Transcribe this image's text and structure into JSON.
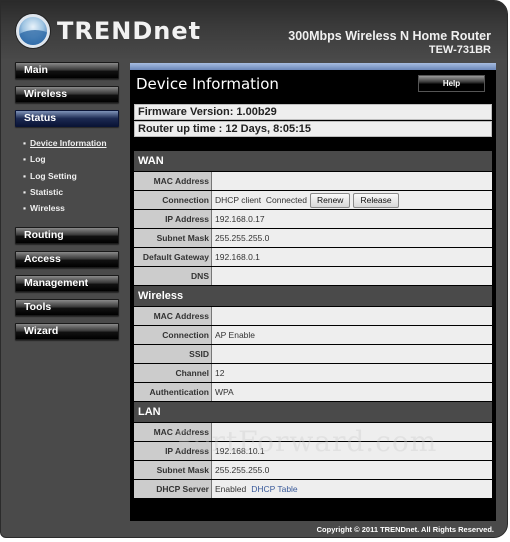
{
  "header": {
    "brand": "TRENDnet",
    "product_line": "300Mbps Wireless N Home Router",
    "model": "TEW-731BR"
  },
  "sidebar": {
    "items": [
      {
        "label": "Main"
      },
      {
        "label": "Wireless"
      },
      {
        "label": "Status",
        "active": true,
        "subitems": [
          {
            "label": "Device Information",
            "active": true
          },
          {
            "label": "Log"
          },
          {
            "label": "Log Setting"
          },
          {
            "label": "Statistic"
          },
          {
            "label": "Wireless"
          }
        ]
      },
      {
        "label": "Routing"
      },
      {
        "label": "Access"
      },
      {
        "label": "Management"
      },
      {
        "label": "Tools"
      },
      {
        "label": "Wizard"
      }
    ],
    "bullet": "▪"
  },
  "main": {
    "title": "Device Information",
    "help_label": "Help",
    "firmware": "Firmware Version: 1.00b29",
    "uptime": "Router up time :  12 Days, 8:05:15",
    "wan": {
      "title": "WAN",
      "rows": [
        {
          "key": "MAC Address",
          "value": ""
        },
        {
          "key": "Connection",
          "value": "DHCP client  Connected"
        },
        {
          "key": "IP Address",
          "value": "192.168.0.17"
        },
        {
          "key": "Subnet Mask",
          "value": "255.255.255.0"
        },
        {
          "key": "Default Gateway",
          "value": "192.168.0.1"
        },
        {
          "key": "DNS",
          "value": ""
        }
      ],
      "renew_label": "Renew",
      "release_label": "Release"
    },
    "wireless": {
      "title": "Wireless",
      "rows": [
        {
          "key": "MAC Address",
          "value": ""
        },
        {
          "key": "Connection",
          "value": "AP Enable"
        },
        {
          "key": "SSID",
          "value": ""
        },
        {
          "key": "Channel",
          "value": "12"
        },
        {
          "key": "Authentication",
          "value": "WPA"
        }
      ]
    },
    "lan": {
      "title": "LAN",
      "rows": [
        {
          "key": "MAC Address",
          "value": ""
        },
        {
          "key": "IP Address",
          "value": "192.168.10.1"
        },
        {
          "key": "Subnet Mask",
          "value": "255.255.255.0"
        },
        {
          "key": "DHCP Server",
          "value": "Enabled"
        }
      ],
      "dhcp_table_link": "DHCP Table"
    }
  },
  "footer": {
    "copyright": "Copyright © 2011 TRENDnet. All Rights Reserved."
  },
  "watermark": "PortForward.com",
  "colors": {
    "frame_bg": "#4a4a4a",
    "active_nav": "#1c2a52",
    "accent_bar": "#8aa3cf",
    "link": "#3a5a9a"
  }
}
